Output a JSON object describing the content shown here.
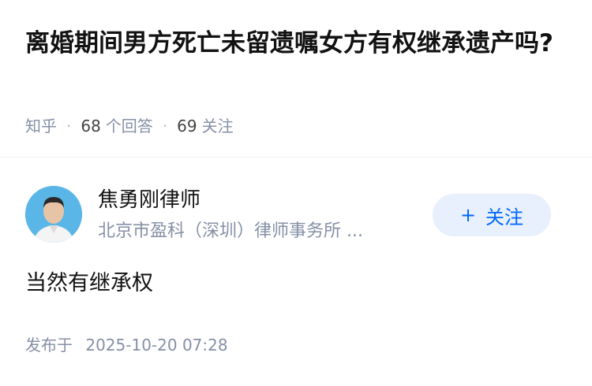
{
  "question": {
    "title": "离婚期间男方死亡未留遗嘱女方有权继承遗产吗?",
    "source": "知乎",
    "answer_count": "68",
    "answer_label": "个回答",
    "follower_count": "69",
    "follower_label": "关注"
  },
  "author": {
    "name": "焦勇刚律师",
    "org": "北京市盈科（深圳）律师事务所 ..."
  },
  "follow_button": {
    "icon": "+",
    "label": "关注"
  },
  "answer": {
    "text": "当然有继承权",
    "published_label": "发布于",
    "published_time": "2025-10-20 07:28"
  }
}
